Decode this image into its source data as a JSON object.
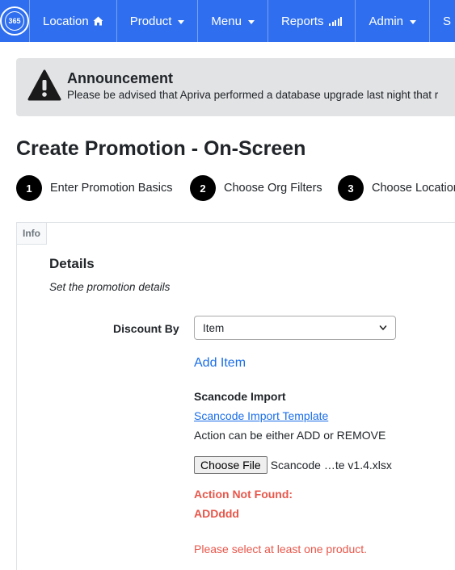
{
  "navbar": {
    "logo_text": "365",
    "items": [
      {
        "label": "Location",
        "icon": "home-icon"
      },
      {
        "label": "Product",
        "icon": "chevron-down-icon"
      },
      {
        "label": "Menu",
        "icon": "chevron-down-icon"
      },
      {
        "label": "Reports",
        "icon": "signal-bars-icon"
      },
      {
        "label": "Admin",
        "icon": "chevron-down-icon"
      },
      {
        "label": "S",
        "icon": ""
      }
    ],
    "color": "#2f6fef"
  },
  "announcement": {
    "title": "Announcement",
    "text": "Please be advised that Apriva performed a database upgrade last night that r",
    "icon": "warning-icon"
  },
  "page": {
    "title": "Create Promotion - On-Screen"
  },
  "steps": [
    {
      "num": "1",
      "label": "Enter Promotion Basics"
    },
    {
      "num": "2",
      "label": "Choose Org Filters"
    },
    {
      "num": "3",
      "label": "Choose Location"
    }
  ],
  "panel": {
    "tab_label": "Info",
    "details_title": "Details",
    "details_subtitle": "Set the promotion details",
    "discount_by_label": "Discount By",
    "discount_by_value": "Item",
    "add_item_label": "Add Item",
    "scancode_title": "Scancode Import",
    "scancode_link": "Scancode Import Template",
    "action_note": "Action can be either ADD or REMOVE",
    "choose_file_label": "Choose File",
    "file_name": "Scancode …te v1.4.xlsx",
    "error_title": "Action Not Found:",
    "error_value": "ADDddd",
    "error_product": "Please select at least one product."
  },
  "colors": {
    "link": "#1a6ee8",
    "error": "#e8564a",
    "announcement_bg": "#e2e3e5"
  }
}
